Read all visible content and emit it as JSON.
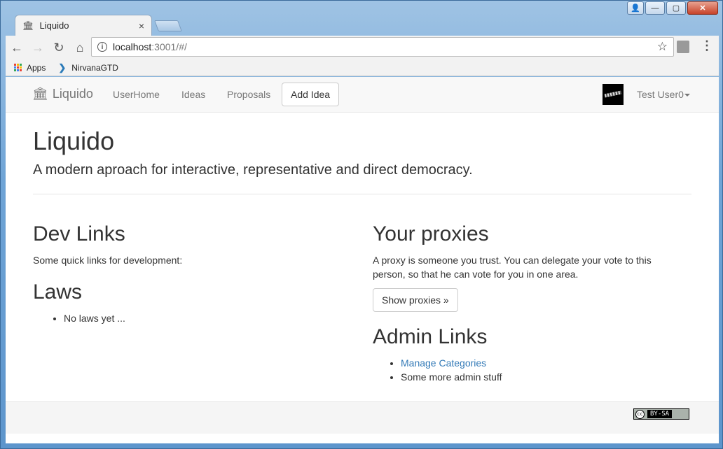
{
  "window": {
    "controls": {
      "user": "👤",
      "minimize": "—",
      "maximize": "▢",
      "close": "✕"
    }
  },
  "tab": {
    "title": "Liquido",
    "icon": "bank-icon",
    "close": "×"
  },
  "toolbar": {
    "back": "←",
    "forward": "→",
    "reload": "↻",
    "home": "⌂",
    "url_host": "localhost",
    "url_rest": ":3001/#/",
    "star": "☆",
    "menu": "⋮"
  },
  "bookmarks": [
    {
      "label": "Apps",
      "icon": "apps-icon"
    },
    {
      "label": "NirvanaGTD",
      "icon": "chevron-right-icon"
    }
  ],
  "navbar": {
    "brand": "Liquido",
    "links": [
      "UserHome",
      "Ideas",
      "Proposals"
    ],
    "add_idea": "Add Idea",
    "user": "Test User0"
  },
  "jumbotron": {
    "title": "Liquido",
    "lead": "A modern aproach for interactive, representative and direct democracy."
  },
  "dev_links": {
    "heading": "Dev Links",
    "text": "Some quick links for development:"
  },
  "laws": {
    "heading": "Laws",
    "items": [
      "No laws yet ..."
    ]
  },
  "proxies": {
    "heading": "Your proxies",
    "text_line1": "A proxy is someone you trust. You can delegate your vote to this",
    "text_line2": "person, so that he can vote for you in one area.",
    "button": "Show proxies »"
  },
  "admin": {
    "heading": "Admin Links",
    "link": "Manage Categories",
    "item": "Some more admin stuff"
  },
  "footer": {
    "cc_logo": "cc",
    "license": "BY-SA"
  },
  "colors": {
    "link": "#337ab7",
    "navbar_bg": "#f8f8f8",
    "text": "#333333"
  }
}
